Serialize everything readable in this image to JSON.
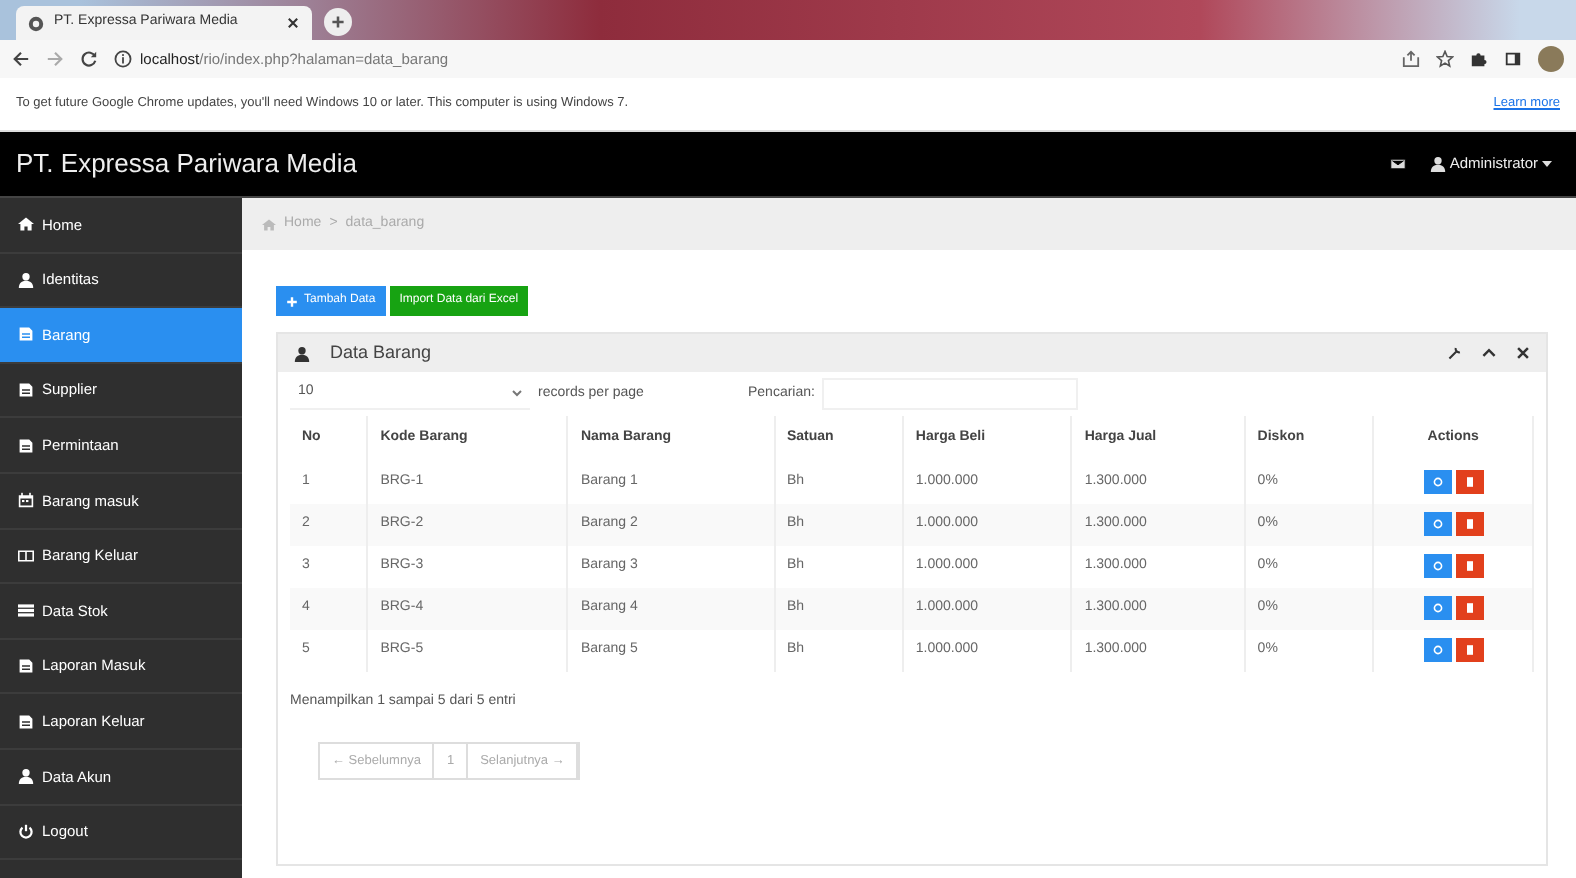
{
  "browser": {
    "tab_title": "PT. Expressa Pariwara Media",
    "url_host": "localhost",
    "url_path": "/rio/index.php?halaman=data_barang",
    "infobar": "To get future Google Chrome updates, you'll need Windows 10 or later. This computer is using Windows 7.",
    "infobar_link": "Learn more"
  },
  "navbar": {
    "brand": "PT. Expressa Pariwara Media",
    "user": "Administrator"
  },
  "sidebar": {
    "items": [
      {
        "label": "Home",
        "selected": false
      },
      {
        "label": "Identitas",
        "selected": false
      },
      {
        "label": "Barang",
        "selected": true
      },
      {
        "label": "Supplier",
        "selected": false
      },
      {
        "label": "Permintaan",
        "selected": false
      },
      {
        "label": "Barang masuk",
        "selected": false
      },
      {
        "label": "Barang Keluar",
        "selected": false
      },
      {
        "label": "Data Stok",
        "selected": false
      },
      {
        "label": "Laporan Masuk",
        "selected": false
      },
      {
        "label": "Laporan Keluar",
        "selected": false
      },
      {
        "label": "Data Akun",
        "selected": false
      },
      {
        "label": "Logout",
        "selected": false
      }
    ]
  },
  "breadcrumb": [
    "Home",
    "data_barang"
  ],
  "breadcrumb_separator": ">",
  "buttons": [
    "Tambah Data",
    "Import Data dari Excel"
  ],
  "panel": {
    "title": "Data Barang",
    "page_size": "10",
    "page_size_label": "records per page",
    "search_label": "Pencarian:",
    "table": {
      "columns": [
        "No",
        "Kode Barang",
        "Nama Barang",
        "Satuan",
        "Harga Beli",
        "Harga Jual",
        "Diskon",
        "Actions"
      ],
      "rows": [
        [
          "1",
          "BRG-1",
          "Barang 1",
          "Bh",
          "1.000.000",
          "1.300.000",
          "0%"
        ],
        [
          "2",
          "BRG-2",
          "Barang 2",
          "Bh",
          "1.000.000",
          "1.300.000",
          "0%"
        ],
        [
          "3",
          "BRG-3",
          "Barang 3",
          "Bh",
          "1.000.000",
          "1.300.000",
          "0%"
        ],
        [
          "4",
          "BRG-4",
          "Barang 4",
          "Bh",
          "1.000.000",
          "1.300.000",
          "0%"
        ],
        [
          "5",
          "BRG-5",
          "Barang 5",
          "Bh",
          "1.000.000",
          "1.300.000",
          "0%"
        ]
      ]
    },
    "info": "Menampilkan 1 sampai 5 dari 5 entri",
    "pagination": [
      "← Sebelumnya",
      "1",
      "Selanjutnya →"
    ]
  }
}
